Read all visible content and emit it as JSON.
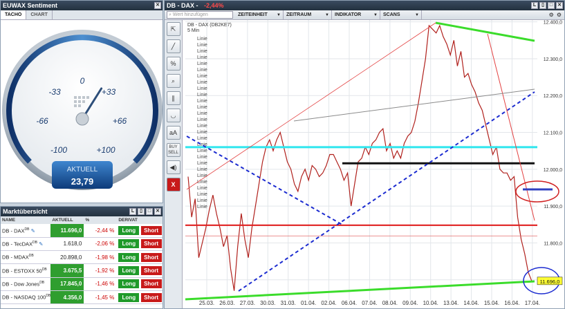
{
  "sentiment": {
    "title": "EUWAX Sentiment",
    "tabs": [
      "TACHO",
      "CHART"
    ],
    "gauge": {
      "labels": [
        "0",
        "-33",
        "+33",
        "-66",
        "+66",
        "-100",
        "+100"
      ],
      "current_label": "AKTUELL",
      "current_value": "23,79",
      "needle_value": 23.79
    }
  },
  "market": {
    "title": "Marktübersicht",
    "headers": [
      "NAME",
      "AKTUELL",
      "%",
      "DERIVAT"
    ],
    "rows": [
      {
        "name": "DB - DAX",
        "sup": "DB",
        "value": "11.696,0",
        "pct": "-2,44 %",
        "long": "Long",
        "short": "Short",
        "highlight": true
      },
      {
        "name": "DB - TecDAX",
        "sup": "DB",
        "value": "1.618,0",
        "pct": "-2,06 %",
        "long": "Long",
        "short": "Short",
        "highlight": false
      },
      {
        "name": "DB - MDAX",
        "sup": "DB",
        "value": "20.898,0",
        "pct": "-1,98 %",
        "long": "Long",
        "short": "Short",
        "highlight": false
      },
      {
        "name": "DB - ESTOXX 50",
        "sup": "DB",
        "value": "3.675,5",
        "pct": "-1,92 %",
        "long": "Long",
        "short": "Short",
        "highlight": true
      },
      {
        "name": "DB - Dow Jones",
        "sup": "DB",
        "value": "17.845,0",
        "pct": "-1,46 %",
        "long": "Long",
        "short": "Short",
        "highlight": true
      },
      {
        "name": "DB - NASDAQ 100",
        "sup": "DB",
        "value": "4.356,0",
        "pct": "-1,45 %",
        "long": "Long",
        "short": "Short",
        "highlight": true
      }
    ]
  },
  "chart_window": {
    "title": "DB - DAX -",
    "change": "-2,44%",
    "search_placeholder": "Wert hinzufügen",
    "menu": [
      "ZEITEINHEIT",
      "ZEITRAUM",
      "INDIKATOR",
      "SCANS"
    ],
    "chart_label": "DB - DAX (DB2KE7)",
    "interval": "5 Min",
    "line_labels": [
      "Linie",
      "Linie",
      "Linie",
      "Linie",
      "Linie",
      "Linie",
      "Linie",
      "Linie",
      "Linie",
      "Linie",
      "Linie",
      "Linie",
      "Linie",
      "Linie",
      "Linie",
      "Linie",
      "Linie",
      "Linie",
      "Linie",
      "Linie",
      "Linie",
      "Linie",
      "Linie",
      "Linie",
      "Linie",
      "Linie",
      "Linie",
      "Linie"
    ],
    "tools": [
      "pointer-icon",
      "line-icon",
      "percent-icon",
      "zoom-icon",
      "parallel-icon",
      "curve-icon",
      "text-icon",
      "buy-sell-icon",
      "sound-icon",
      "close-icon"
    ],
    "tool_labels": {
      "text": "aA",
      "buysell": "BUY SELL",
      "close": "X"
    },
    "current_price_label": "11.696,0"
  },
  "chart_data": {
    "type": "line",
    "title": "DB - DAX (DB2KE7)",
    "x_ticks": [
      "25.03.",
      "26.03.",
      "27.03.",
      "30.03.",
      "31.03.",
      "01.04.",
      "02.04.",
      "06.04.",
      "07.04.",
      "08.04.",
      "09.04.",
      "10.04.",
      "13.04.",
      "14.04.",
      "15.04.",
      "16.04.",
      "17.04."
    ],
    "y_ticks": [
      "12.400,0",
      "12.300,0",
      "12.200,0",
      "12.100,0",
      "12.000,0",
      "11.900,0",
      "11.800,0",
      "11.700,0"
    ],
    "y_values": [
      12400,
      12300,
      12200,
      12100,
      12000,
      11900,
      11800,
      11700
    ],
    "ylim": [
      11645,
      12405
    ],
    "series": [
      {
        "values": [
          11980,
          11870,
          11920,
          11760,
          11800,
          11840,
          11890,
          11930,
          11880,
          11840,
          11790,
          11820,
          11730,
          11670,
          11790,
          11880,
          11810,
          11760,
          11840,
          11900,
          11960,
          12020,
          12060,
          12080,
          12050,
          12080,
          12100,
          12060,
          12020,
          12000,
          11960,
          11940,
          11980,
          12000,
          11970,
          12010,
          12000,
          11980,
          11990,
          12010,
          12040,
          12040,
          12020,
          12000,
          11970,
          11990,
          11900,
          11960,
          12020,
          12030,
          12060,
          12040,
          12070,
          12080,
          12100,
          12110,
          12050,
          12070,
          12030,
          12050,
          12030,
          12070,
          12090,
          12100,
          12130,
          12180,
          12240,
          12300,
          12390,
          12380,
          12370,
          12390,
          12360,
          12340,
          12310,
          12350,
          12280,
          12320,
          12250,
          12260,
          12230,
          12210,
          12180,
          12160,
          12120,
          12080,
          12040,
          12060,
          12000,
          11990,
          11990,
          11970,
          11980,
          11870,
          11810,
          11770,
          11720,
          11696
        ]
      }
    ],
    "horizontal_levels": [
      12060,
      12016,
      11848,
      11819
    ],
    "legend": "none",
    "grid": true
  }
}
